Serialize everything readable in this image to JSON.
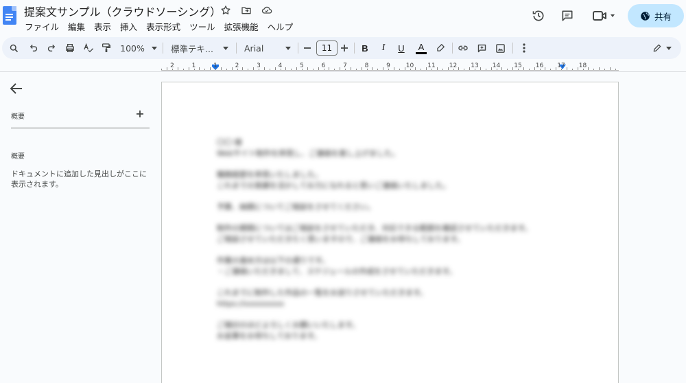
{
  "header": {
    "title": "提案文サンプル（クラウドソーシング）",
    "share_label": "共有"
  },
  "menu": [
    "ファイル",
    "編集",
    "表示",
    "挿入",
    "表示形式",
    "ツール",
    "拡張機能",
    "ヘルプ"
  ],
  "toolbar": {
    "zoom": "100%",
    "style": "標準テキ...",
    "font": "Arial",
    "font_size": "11"
  },
  "ruler": {
    "labels": [
      "2",
      "1",
      "1",
      "2",
      "3",
      "4",
      "5",
      "6",
      "7",
      "8",
      "9",
      "10",
      "11",
      "12",
      "13",
      "14",
      "15",
      "16",
      "17",
      "18"
    ]
  },
  "sidebar": {
    "title": "概要",
    "subtitle": "概要",
    "hint": "ドキュメントに追加した見出しがここに表示されます。"
  },
  "document": {
    "lines": [
      "〇〇 様",
      "Webサイト制作を拝見し、ご連絡を差し上げました。",
      "",
      "職務経歴を拝見いたしました。",
      "これまでの実績を活かしてお力になれると思いご連絡いたしました。",
      "",
      "予算、納期についてご相談をさせてください。",
      "",
      "制作の期間についてはご相談をさせていただき、対応できる範囲を確認させていただきます。",
      "ご相談させていただきたく思いますので、ご連絡をお待ちしております。",
      "",
      "作業の進め方は以下の通りです。",
      "・ご連絡いただきまして、スケジュールの作成をさせていただきます。",
      "",
      "これまでに制作した作品の一覧をお送りさせていただきます。",
      "https://xxxxxxxxx",
      "",
      "ご検討のほどよろしくお願いいたします。",
      "お返事をお待ちしております。"
    ]
  },
  "colors": {
    "accent": "#0b57d0",
    "share_bg": "#c2e7ff",
    "toolbar_bg": "#edf2fa",
    "doc_icon": "#4285f4"
  }
}
